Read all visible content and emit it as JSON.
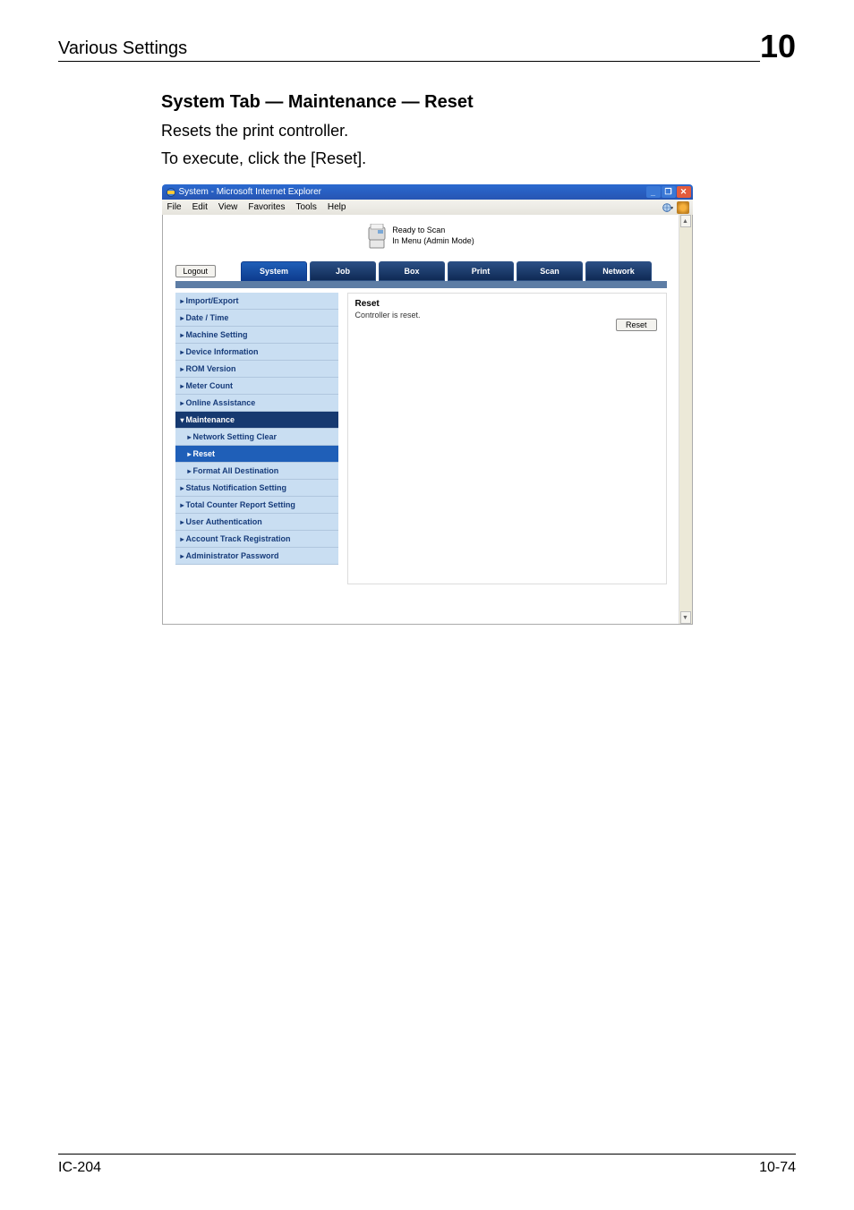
{
  "header": {
    "title": "Various Settings",
    "chapter": "10"
  },
  "section": {
    "heading": "System Tab — Maintenance — Reset",
    "line1": "Resets the print controller.",
    "line2": "To execute, click the [Reset]."
  },
  "window": {
    "title": "System - Microsoft Internet Explorer",
    "menu": {
      "file": "File",
      "edit": "Edit",
      "view": "View",
      "fav": "Favorites",
      "tools": "Tools",
      "help": "Help"
    }
  },
  "status": {
    "line1": "Ready to Scan",
    "line2": "In Menu (Admin Mode)"
  },
  "logout": "Logout",
  "tabs": {
    "system": "System",
    "job": "Job",
    "box": "Box",
    "print": "Print",
    "scan": "Scan",
    "network": "Network"
  },
  "sidebar": [
    {
      "key": "import_export",
      "label": "Import/Export",
      "cls": "side-item tri"
    },
    {
      "key": "date_time",
      "label": "Date / Time",
      "cls": "side-item tri"
    },
    {
      "key": "machine_setting",
      "label": "Machine Setting",
      "cls": "side-item tri"
    },
    {
      "key": "device_info",
      "label": "Device Information",
      "cls": "side-item tri"
    },
    {
      "key": "rom_version",
      "label": "ROM Version",
      "cls": "side-item tri"
    },
    {
      "key": "meter_count",
      "label": "Meter Count",
      "cls": "side-item tri"
    },
    {
      "key": "online_assist",
      "label": "Online Assistance",
      "cls": "side-item tri"
    },
    {
      "key": "maintenance",
      "label": "Maintenance",
      "cls": "side-item dark trid"
    },
    {
      "key": "net_set_clear",
      "label": "Network Setting Clear",
      "cls": "side-item sub tri"
    },
    {
      "key": "reset",
      "label": "Reset",
      "cls": "side-item sub active tri"
    },
    {
      "key": "format_all_dest",
      "label": "Format All Destination",
      "cls": "side-item sub tri"
    },
    {
      "key": "status_notif",
      "label": "Status Notification Setting",
      "cls": "side-item tri"
    },
    {
      "key": "total_counter",
      "label": "Total Counter Report Setting",
      "cls": "side-item tri"
    },
    {
      "key": "user_auth",
      "label": "User Authentication",
      "cls": "side-item tri"
    },
    {
      "key": "acct_track_reg",
      "label": "Account Track Registration",
      "cls": "side-item tri"
    },
    {
      "key": "admin_pw",
      "label": "Administrator Password",
      "cls": "side-item tri"
    }
  ],
  "panel": {
    "title": "Reset",
    "text": "Controller is reset.",
    "button": "Reset"
  },
  "footer": {
    "left": "IC-204",
    "right": "10-74"
  }
}
